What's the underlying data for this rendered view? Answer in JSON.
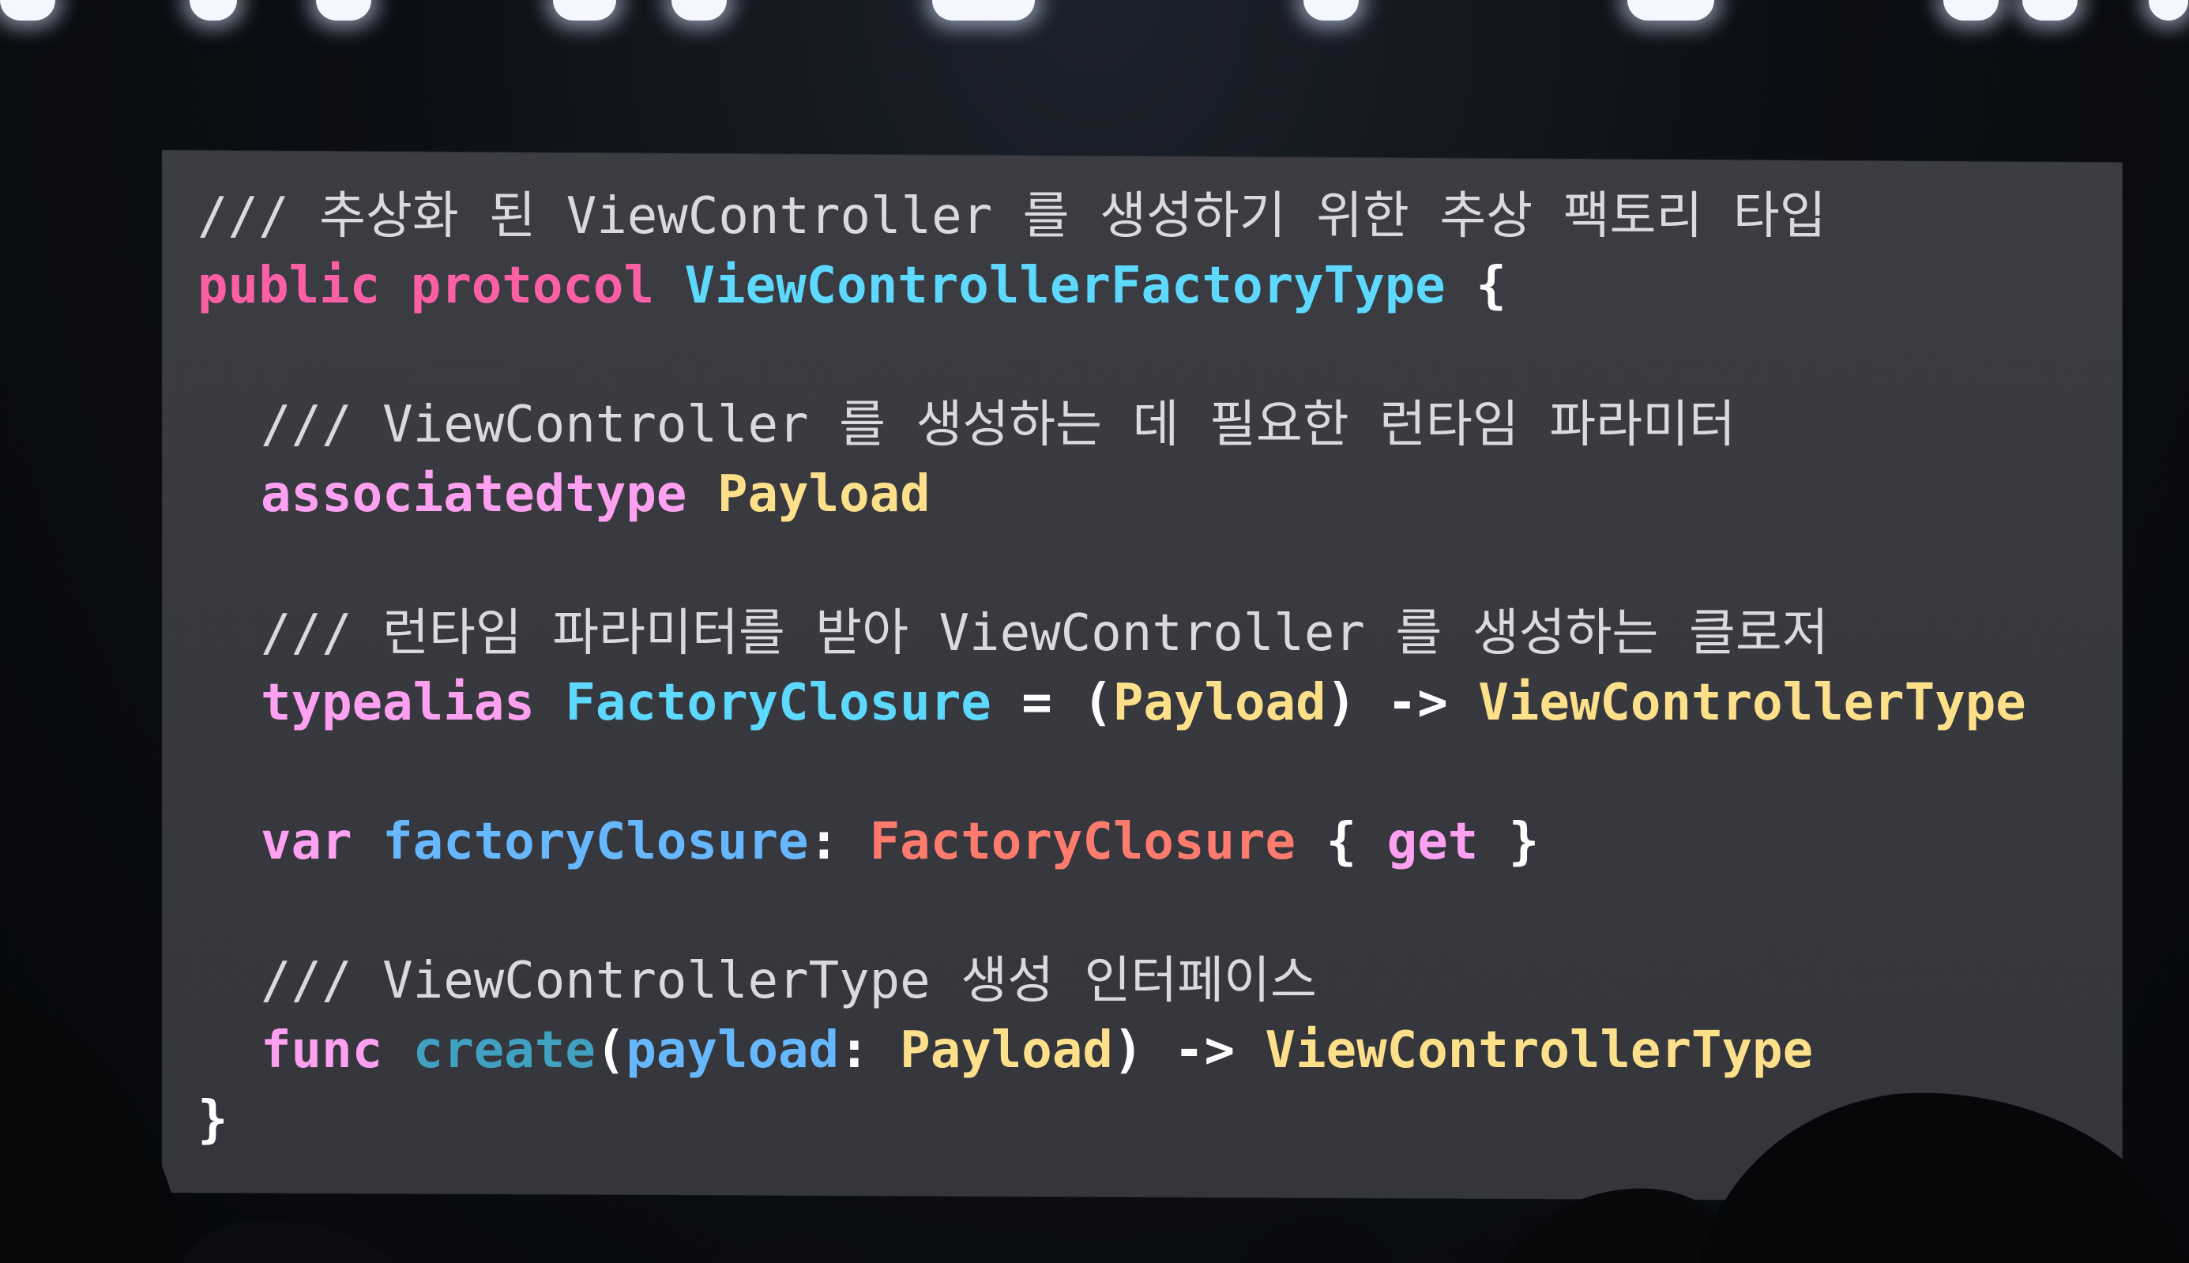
{
  "slide": {
    "lines": [
      {
        "indent": false,
        "parts": [
          {
            "cls": "comment",
            "text": "/// 추상화 된 ViewController 를 생성하기 위한 추상 팩토리 타입"
          }
        ]
      },
      {
        "indent": false,
        "parts": [
          {
            "cls": "kw",
            "text": "public protocol "
          },
          {
            "cls": "type-decl",
            "text": "ViewControllerFactoryType"
          },
          {
            "cls": "plain",
            "text": " {"
          }
        ]
      },
      {
        "indent": false,
        "parts": [
          {
            "cls": "plain",
            "text": " "
          }
        ]
      },
      {
        "indent": true,
        "parts": [
          {
            "cls": "comment",
            "text": "/// ViewController 를 생성하는 데 필요한 런타임 파라미터"
          }
        ]
      },
      {
        "indent": true,
        "parts": [
          {
            "cls": "kw2",
            "text": "associatedtype "
          },
          {
            "cls": "type-ref",
            "text": "Payload"
          }
        ]
      },
      {
        "indent": false,
        "parts": [
          {
            "cls": "plain",
            "text": " "
          }
        ]
      },
      {
        "indent": true,
        "parts": [
          {
            "cls": "comment",
            "text": "/// 런타임 파라미터를 받아 ViewController 를 생성하는 클로저"
          }
        ]
      },
      {
        "indent": true,
        "parts": [
          {
            "cls": "kw2",
            "text": "typealias "
          },
          {
            "cls": "type-decl",
            "text": "FactoryClosure"
          },
          {
            "cls": "plain",
            "text": " = ("
          },
          {
            "cls": "type-ref",
            "text": "Payload"
          },
          {
            "cls": "plain",
            "text": ") -> "
          },
          {
            "cls": "type-ref",
            "text": "ViewControllerType"
          }
        ]
      },
      {
        "indent": false,
        "parts": [
          {
            "cls": "plain",
            "text": " "
          }
        ]
      },
      {
        "indent": true,
        "parts": [
          {
            "cls": "kw2",
            "text": "var "
          },
          {
            "cls": "param",
            "text": "factoryClosure"
          },
          {
            "cls": "plain",
            "text": ": "
          },
          {
            "cls": "red",
            "text": "FactoryClosure"
          },
          {
            "cls": "plain",
            "text": " { "
          },
          {
            "cls": "kw2",
            "text": "get"
          },
          {
            "cls": "plain",
            "text": " }"
          }
        ]
      },
      {
        "indent": false,
        "parts": [
          {
            "cls": "plain",
            "text": " "
          }
        ]
      },
      {
        "indent": true,
        "parts": [
          {
            "cls": "comment",
            "text": "/// ViewControllerType 생성 인터페이스"
          }
        ]
      },
      {
        "indent": true,
        "parts": [
          {
            "cls": "kw2",
            "text": "func "
          },
          {
            "cls": "func-decl",
            "text": "create"
          },
          {
            "cls": "plain",
            "text": "("
          },
          {
            "cls": "param",
            "text": "payload"
          },
          {
            "cls": "plain",
            "text": ": "
          },
          {
            "cls": "type-ref",
            "text": "Payload"
          },
          {
            "cls": "plain",
            "text": ") -> "
          },
          {
            "cls": "type-ref",
            "text": "ViewControllerType"
          }
        ]
      },
      {
        "indent": false,
        "parts": [
          {
            "cls": "plain",
            "text": "}"
          }
        ]
      }
    ]
  }
}
